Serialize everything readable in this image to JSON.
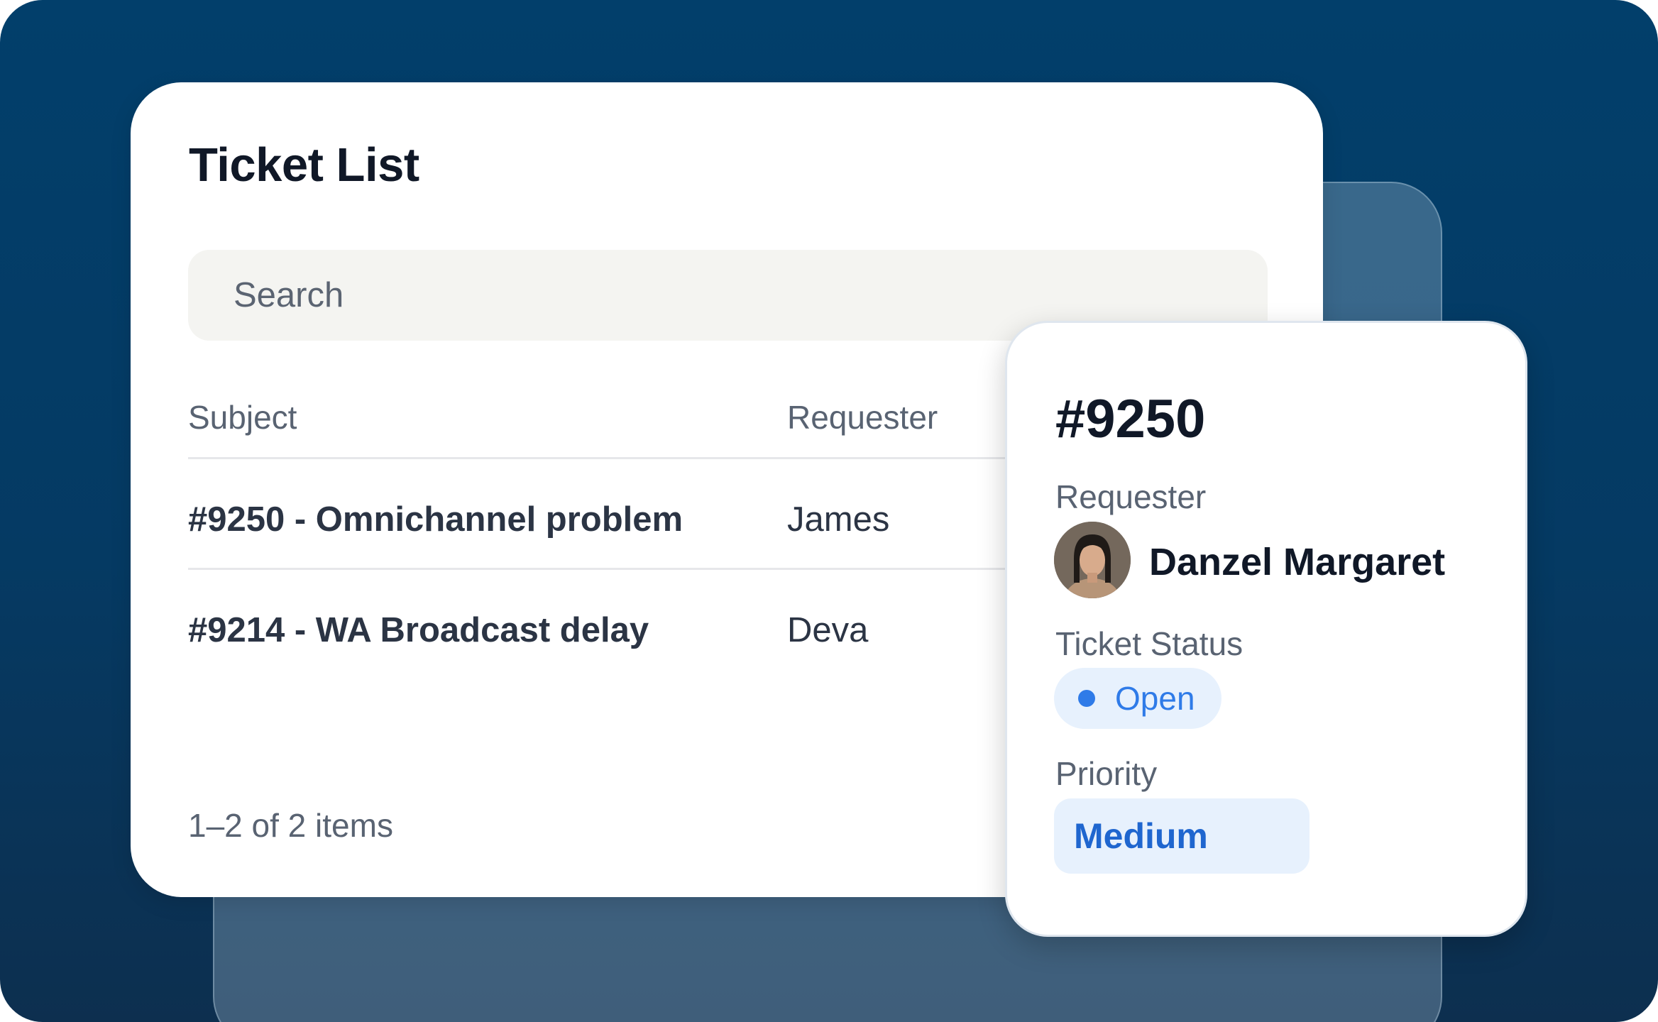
{
  "ticket_list": {
    "title": "Ticket List",
    "search_placeholder": "Search",
    "columns": {
      "subject": "Subject",
      "requester": "Requester"
    },
    "rows": [
      {
        "subject": "#9250 - Omnichannel problem",
        "requester": "James"
      },
      {
        "subject": "#9214 - WA Broadcast delay",
        "requester": "Deva"
      }
    ],
    "pagination": "1–2 of 2 items"
  },
  "ticket_detail": {
    "id": "#9250",
    "requester_label": "Requester",
    "requester_name": "Danzel Margaret",
    "avatar_icon": "person-photo",
    "status_label": "Ticket Status",
    "status_value": "Open",
    "priority_label": "Priority",
    "priority_value": "Medium"
  },
  "colors": {
    "background": "#023f6b",
    "status_accent": "#2f7be8",
    "priority_text": "#1f66cf",
    "pill_background": "#e7f1fd"
  }
}
